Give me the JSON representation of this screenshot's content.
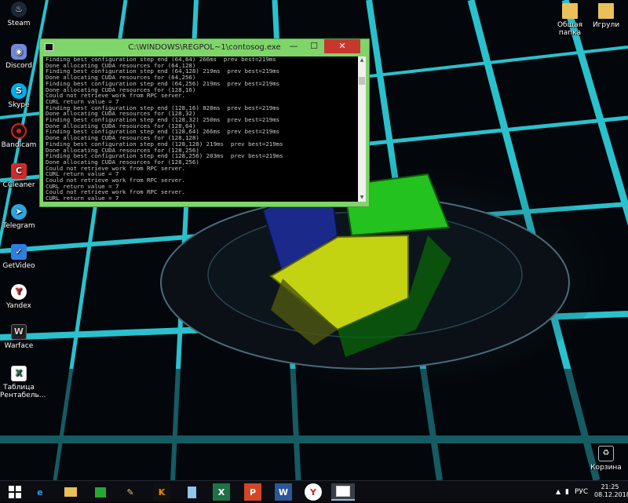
{
  "desktop_icons_left": [
    {
      "label": "Steam",
      "icon": "steam-icon"
    },
    {
      "label": "Discord",
      "icon": "discord-icon"
    },
    {
      "label": "Skype",
      "icon": "skype-icon"
    },
    {
      "label": "Bandicam",
      "icon": "bandicam-icon"
    },
    {
      "label": "CCleaner",
      "icon": "ccleaner-icon"
    },
    {
      "label": "Telegram",
      "icon": "telegram-icon"
    },
    {
      "label": "GetVideo",
      "icon": "getvideo-icon"
    },
    {
      "label": "Yandex",
      "icon": "yandex-icon"
    },
    {
      "label": "Warface",
      "icon": "warface-icon"
    },
    {
      "label_line1": "Таблица",
      "label_line2": "Рентабель...",
      "icon": "excel-file-icon"
    }
  ],
  "desktop_icons_right": {
    "shared_folder": {
      "line1": "Общая",
      "line2": "папка"
    },
    "games_folder": "Игрули",
    "recycle_bin": "Корзина"
  },
  "console_window": {
    "title": "C:\\WINDOWS\\REGPOL~1\\contosog.exe",
    "lines": [
      "Finding best configuration step end (64,64) 266ms  prev best=219ms",
      "Done allocating CUDA resources for (64,128)",
      "Finding best configuration step end (64,128) 219ms  prev best=219ms",
      "Done allocating CUDA resources for (64,256)",
      "Finding best configuration step end (64,256) 219ms  prev best=219ms",
      "Done allocating CUDA resources for (128,16)",
      "Could not retrieve work from RPC server.",
      "CURL return value = 7",
      "Finding best configuration step end (128,16) 828ms  prev best=219ms",
      "Done allocating CUDA resources for (128,32)",
      "Finding best configuration step end (128,32) 250ms  prev best=219ms",
      "Done allocating CUDA resources for (128,64)",
      "Finding best configuration step end (128,64) 266ms  prev best=219ms",
      "Done allocating CUDA resources for (128,128)",
      "Finding best configuration step end (128,128) 219ms  prev best=219ms",
      "Done allocating CUDA resources for (128,256)",
      "Finding best configuration step end (128,256) 203ms  prev best=219ms",
      "Done allocating CUDA resources for (128,256)",
      "Could not retrieve work from RPC server.",
      "CURL return value = 7",
      "Could not retrieve work from RPC server.",
      "CURL return value = 7",
      "Could not retrieve work from RPC server.",
      "CURL return value = 7",
      "_"
    ],
    "buttons": {
      "minimize": "—",
      "maximize": "☐",
      "close": "✕"
    }
  },
  "taskbar": {
    "language": "РУС",
    "time": "21:25",
    "date": "08.12.2018",
    "apps": [
      "windows-start-icon",
      "internet-explorer-icon",
      "file-explorer-icon",
      "store-icon",
      "paint-icon",
      "k-app-icon",
      "notepad-icon",
      "excel-icon",
      "powerpoint-icon",
      "word-icon",
      "yandex-browser-icon",
      "console-window-icon"
    ]
  },
  "colors": {
    "window_frame": "#7fd56a",
    "close_button": "#c7372d",
    "grid_cyan": "#2fd6e3"
  }
}
